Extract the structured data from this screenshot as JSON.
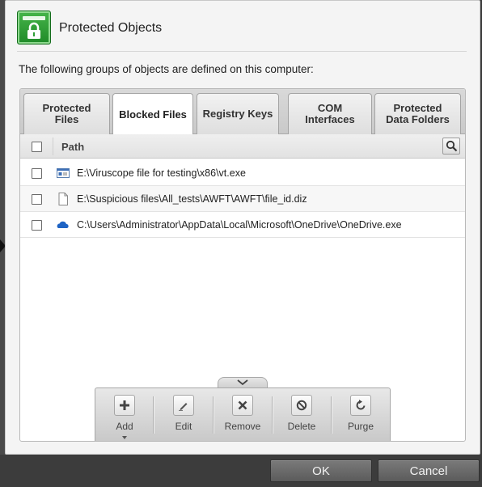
{
  "dialog": {
    "title": "Protected Objects",
    "description": "The following groups of objects are defined on this computer:",
    "icon": "lock-icon"
  },
  "tabs": [
    {
      "label": "Protected\nFiles",
      "active": false
    },
    {
      "label": "Blocked Files",
      "active": true
    },
    {
      "label": "Registry Keys",
      "active": false
    },
    {
      "label": "COM\nInterfaces",
      "active": false
    },
    {
      "label": "Protected\nData Folders",
      "active": false
    }
  ],
  "table": {
    "column_header": "Path",
    "rows": [
      {
        "path": "E:\\Viruscope file for testing\\x86\\vt.exe",
        "icon": "exe-window-icon",
        "checked": false
      },
      {
        "path": "E:\\Suspicious files\\All_tests\\AWFT\\AWFT\\file_id.diz",
        "icon": "blank-file-icon",
        "checked": false
      },
      {
        "path": "C:\\Users\\Administrator\\AppData\\Local\\Microsoft\\OneDrive\\OneDrive.exe",
        "icon": "onedrive-cloud-icon",
        "checked": false
      }
    ]
  },
  "toolbar": {
    "add": "Add",
    "edit": "Edit",
    "remove": "Remove",
    "delete": "Delete",
    "purge": "Purge"
  },
  "footer": {
    "ok": "OK",
    "cancel": "Cancel"
  },
  "colors": {
    "accent_green": "#2e9e36",
    "footer_bg": "#3c3c3c",
    "button_gray": "#6a6a6a"
  }
}
